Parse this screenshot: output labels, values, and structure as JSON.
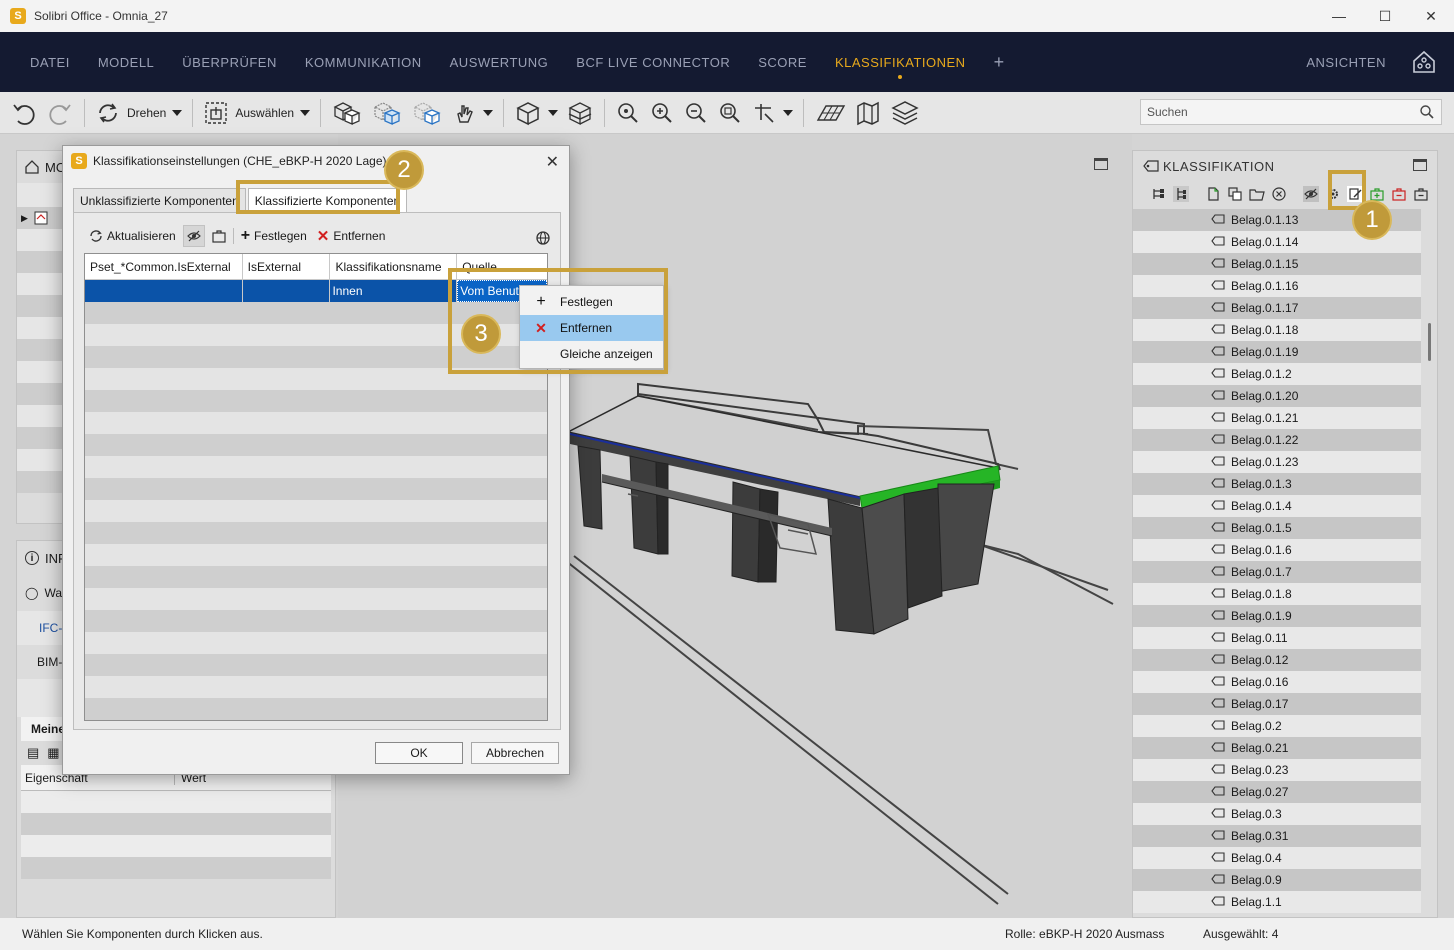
{
  "window": {
    "title": "Solibri Office - Omnia_27",
    "logo_letter": "S"
  },
  "menu": {
    "items": [
      "DATEI",
      "MODELL",
      "ÜBERPRÜFEN",
      "KOMMUNIKATION",
      "AUSWERTUNG",
      "BCF LIVE CONNECTOR",
      "SCORE",
      "KLASSIFIKATIONEN"
    ],
    "active_index": 7,
    "plus": "+",
    "right_label": "ANSICHTEN"
  },
  "toolbar": {
    "rotate_label": "Drehen",
    "select_label": "Auswählen",
    "search_placeholder": "Suchen"
  },
  "left_panel": {
    "title_partial": "MO",
    "info_partial": "INF",
    "wa_partial": "Wa",
    "ifc_partial": "IFC-",
    "bim_partial": "BIM-",
    "meine_partial": "Meine",
    "col_property": "Eigenschaft",
    "col_value": "Wert"
  },
  "dialog": {
    "title": "Klassifikationseinstellungen (CHE_eBKP-H 2020 Lage)",
    "tabs": [
      "Unklassifizierte Komponenten",
      "Klassifizierte Komponenten"
    ],
    "tools": {
      "refresh": "Aktualisieren",
      "assign": "Festlegen",
      "remove": "Entfernen"
    },
    "columns": [
      "Pset_*Common.IsExternal",
      "IsExternal",
      "Klassifikationsname",
      "Quelle"
    ],
    "row": {
      "c1": "",
      "c2": "",
      "c3": "Innen",
      "c4": "Vom Benutz"
    },
    "ok": "OK",
    "cancel": "Abbrechen"
  },
  "context_menu": {
    "items": [
      "Festlegen",
      "Entfernen",
      "Gleiche anzeigen"
    ],
    "hover_index": 1
  },
  "right_panel": {
    "title": "KLASSIFIKATION",
    "items": [
      "Belag.0.1.13",
      "Belag.0.1.14",
      "Belag.0.1.15",
      "Belag.0.1.16",
      "Belag.0.1.17",
      "Belag.0.1.18",
      "Belag.0.1.19",
      "Belag.0.1.2",
      "Belag.0.1.20",
      "Belag.0.1.21",
      "Belag.0.1.22",
      "Belag.0.1.23",
      "Belag.0.1.3",
      "Belag.0.1.4",
      "Belag.0.1.5",
      "Belag.0.1.6",
      "Belag.0.1.7",
      "Belag.0.1.8",
      "Belag.0.1.9",
      "Belag.0.11",
      "Belag.0.12",
      "Belag.0.16",
      "Belag.0.17",
      "Belag.0.2",
      "Belag.0.21",
      "Belag.0.23",
      "Belag.0.27",
      "Belag.0.3",
      "Belag.0.31",
      "Belag.0.4",
      "Belag.0.9",
      "Belag.1.1"
    ]
  },
  "status": {
    "message": "Wählen Sie Komponenten durch Klicken aus.",
    "role": "Rolle: eBKP-H 2020 Ausmass",
    "selected": "Ausgewählt: 4"
  },
  "annotations": {
    "b1": "1",
    "b2": "2",
    "b3": "3"
  },
  "colors": {
    "accent": "#e8a91c",
    "menu_bg": "#141a31",
    "selection": "#0b53a8",
    "highlight_green": "#1db31d",
    "callout": "#c09a3a"
  }
}
